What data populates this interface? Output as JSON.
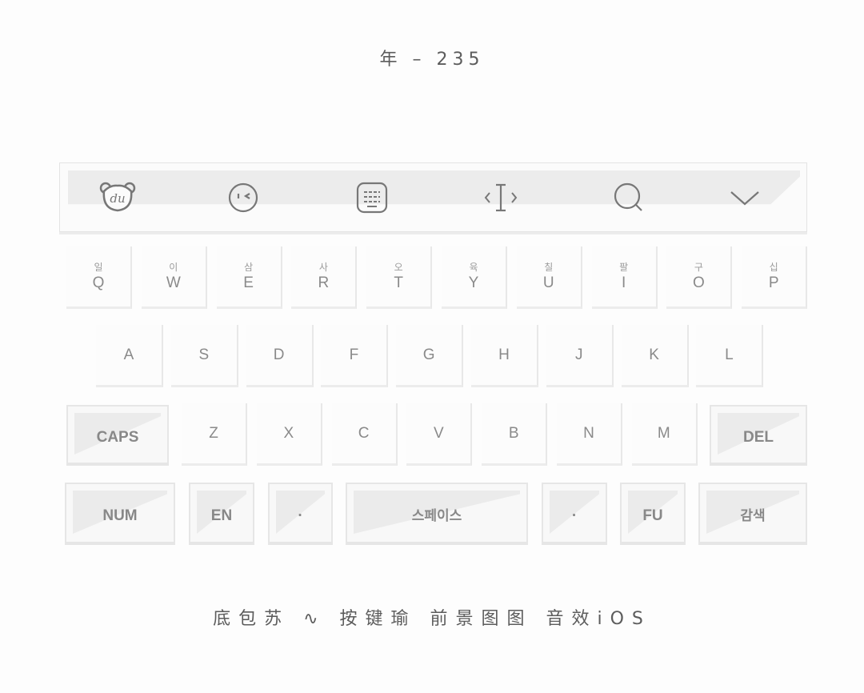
{
  "header": {
    "title": "年 – 235"
  },
  "toolbar": {
    "buttons": [
      {
        "name": "du-logo-icon"
      },
      {
        "name": "emoji-icon"
      },
      {
        "name": "keyboard-layout-icon"
      },
      {
        "name": "cursor-move-icon"
      },
      {
        "name": "search-icon"
      },
      {
        "name": "collapse-keyboard-icon"
      }
    ]
  },
  "rows": {
    "row1": [
      {
        "label": "Q",
        "hint": "일"
      },
      {
        "label": "W",
        "hint": "이"
      },
      {
        "label": "E",
        "hint": "삼"
      },
      {
        "label": "R",
        "hint": "사"
      },
      {
        "label": "T",
        "hint": "오"
      },
      {
        "label": "Y",
        "hint": "육"
      },
      {
        "label": "U",
        "hint": "칠"
      },
      {
        "label": "I",
        "hint": "팔"
      },
      {
        "label": "O",
        "hint": "구"
      },
      {
        "label": "P",
        "hint": "십"
      }
    ],
    "row2": [
      {
        "label": "A"
      },
      {
        "label": "S"
      },
      {
        "label": "D"
      },
      {
        "label": "F"
      },
      {
        "label": "G"
      },
      {
        "label": "H"
      },
      {
        "label": "J"
      },
      {
        "label": "K"
      },
      {
        "label": "L"
      }
    ],
    "row3": {
      "caps": "CAPS",
      "letters": [
        {
          "label": "Z"
        },
        {
          "label": "X"
        },
        {
          "label": "C"
        },
        {
          "label": "V"
        },
        {
          "label": "B"
        },
        {
          "label": "N"
        },
        {
          "label": "M"
        }
      ],
      "del": "DEL"
    },
    "row4": {
      "num": "NUM",
      "en": "EN",
      "comma": "·",
      "space": "스페이스",
      "period": "·",
      "fu": "FU",
      "search": "감색"
    }
  },
  "footer": {
    "text": "底包苏 ∿ 按键瑜 前景图图 音效iOS"
  }
}
